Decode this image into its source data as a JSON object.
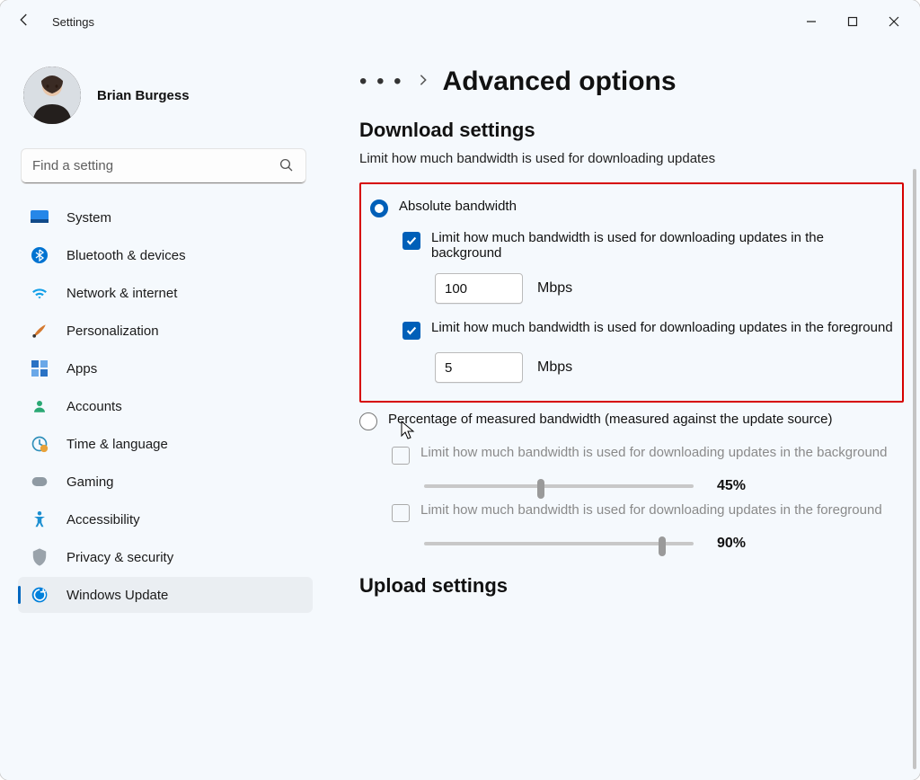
{
  "titlebar": {
    "app_title": "Settings"
  },
  "profile": {
    "name": "Brian Burgess"
  },
  "search": {
    "placeholder": "Find a setting"
  },
  "nav": {
    "items": [
      {
        "id": "system",
        "label": "System",
        "color": "#0078d4"
      },
      {
        "id": "bluetooth",
        "label": "Bluetooth & devices",
        "color": "#0078d4"
      },
      {
        "id": "network",
        "label": "Network & internet",
        "color": "#0091ff"
      },
      {
        "id": "personalization",
        "label": "Personalization",
        "color": "#d06f2e"
      },
      {
        "id": "apps",
        "label": "Apps",
        "color": "#2e72c9"
      },
      {
        "id": "accounts",
        "label": "Accounts",
        "color": "#26a36f"
      },
      {
        "id": "time",
        "label": "Time & language",
        "color": "#2c8eb5"
      },
      {
        "id": "gaming",
        "label": "Gaming",
        "color": "#8f9aa3"
      },
      {
        "id": "accessibility",
        "label": "Accessibility",
        "color": "#1d8ecf"
      },
      {
        "id": "privacy",
        "label": "Privacy & security",
        "color": "#8f9aa3"
      },
      {
        "id": "update",
        "label": "Windows Update",
        "color": "#0078d4"
      }
    ]
  },
  "breadcrumb": {
    "page_title": "Advanced options"
  },
  "download": {
    "section_title": "Download settings",
    "subtitle": "Limit how much bandwidth is used for downloading updates",
    "absolute_label": "Absolute bandwidth",
    "bg_check_label": "Limit how much bandwidth is used for downloading updates in the background",
    "bg_value": "100",
    "fg_check_label": "Limit how much bandwidth is used for downloading updates in the foreground",
    "fg_value": "5",
    "unit": "Mbps",
    "percent_label": "Percentage of measured bandwidth (measured against the update source)",
    "pct_bg_label": "Limit how much bandwidth is used for downloading updates in the background",
    "pct_bg_value": "45%",
    "pct_fg_label": "Limit how much bandwidth is used for downloading updates in the foreground",
    "pct_fg_value": "90%"
  },
  "upload": {
    "section_title": "Upload settings"
  }
}
